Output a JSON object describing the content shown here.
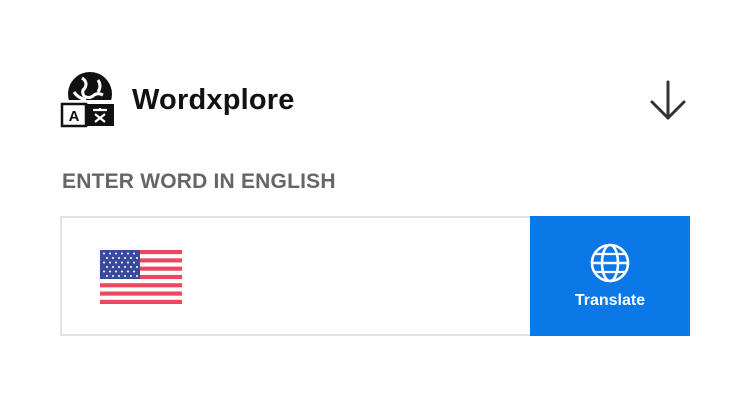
{
  "app": {
    "title": "Wordxplore",
    "logo_icon": "translate-globe-icon",
    "download_icon": "arrow-down-icon"
  },
  "form": {
    "label": "ENTER WORD IN ENGLISH",
    "input_value": "",
    "input_placeholder": "",
    "flag_icon": "us-flag-icon",
    "translate_label": "Translate",
    "translate_icon": "globe-icon"
  },
  "colors": {
    "accent": "#0a78e6",
    "label": "#666666",
    "title": "#111111",
    "border": "#e2e2e2",
    "flag_red": "#e8495f",
    "flag_blue": "#3b4b9c"
  }
}
